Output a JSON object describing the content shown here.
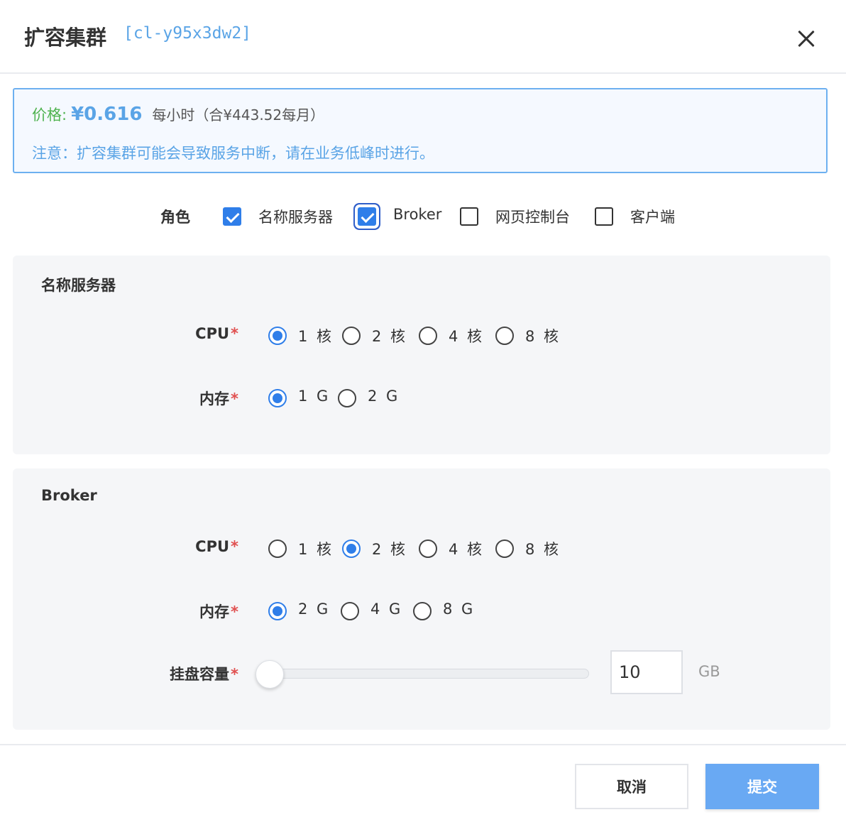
{
  "dialog": {
    "title": "扩容集群",
    "cluster_id": "[cl-y95x3dw2]"
  },
  "notice": {
    "price_label": "价格:",
    "price_value": "¥0.616",
    "price_unit": "每小时（合¥443.52每月）",
    "warning": "注意：扩容集群可能会导致服务中断，请在业务低峰时进行。"
  },
  "roles": {
    "label": "角色",
    "items": [
      {
        "label": "名称服务器",
        "checked": true
      },
      {
        "label": "Broker",
        "checked": true
      },
      {
        "label": "网页控制台",
        "checked": false
      },
      {
        "label": "客户端",
        "checked": false
      }
    ]
  },
  "name_server": {
    "title": "名称服务器",
    "cpu_label": "CPU",
    "cpu_options": [
      "1 核",
      "2 核",
      "4 核",
      "8 核"
    ],
    "cpu_selected": "1 核",
    "mem_label": "内存",
    "mem_options": [
      "1 G",
      "2 G"
    ],
    "mem_selected": "1 G"
  },
  "broker": {
    "title": "Broker",
    "cpu_label": "CPU",
    "cpu_options": [
      "1 核",
      "2 核",
      "4 核",
      "8 核"
    ],
    "cpu_selected": "2 核",
    "mem_label": "内存",
    "mem_options": [
      "2 G",
      "4 G",
      "8 G"
    ],
    "mem_selected": "2 G",
    "disk_label": "挂盘容量",
    "disk_value": "10",
    "disk_unit": "GB",
    "disk_level_percent": 0
  },
  "required_mark": "*",
  "footer": {
    "cancel_label": "取消",
    "submit_label": "提交"
  },
  "colors": {
    "accent": "#2f7ee9",
    "price_label": "#4fb34f",
    "info_blue": "#5aa4e6",
    "submit_bg": "#69a9f3"
  }
}
